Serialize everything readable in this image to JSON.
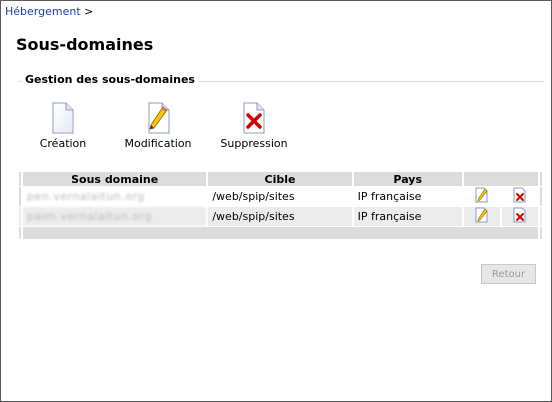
{
  "breadcrumb": {
    "link": "Hébergement",
    "separator": " >"
  },
  "page": {
    "title": "Sous-domaines"
  },
  "section": {
    "legend": "Gestion des sous-domaines"
  },
  "actions": [
    {
      "label": "Création",
      "icon": "new-document-icon"
    },
    {
      "label": "Modification",
      "icon": "edit-document-icon"
    },
    {
      "label": "Suppression",
      "icon": "delete-document-icon"
    }
  ],
  "table": {
    "headers": [
      "Sous domaine",
      "Cible",
      "Pays"
    ],
    "rows": [
      {
        "subdomain": "pen.vernalaitun.org",
        "target": "/web/spip/sites",
        "country": "IP française"
      },
      {
        "subdomain": "paim.vernalaitun.org",
        "target": "/web/spip/sites",
        "country": "IP française"
      }
    ]
  },
  "buttons": {
    "retour": "Retour"
  },
  "colors": {
    "link": "#1a3ea8",
    "header_bg": "#dcdcdc",
    "delete_red": "#d40000"
  }
}
